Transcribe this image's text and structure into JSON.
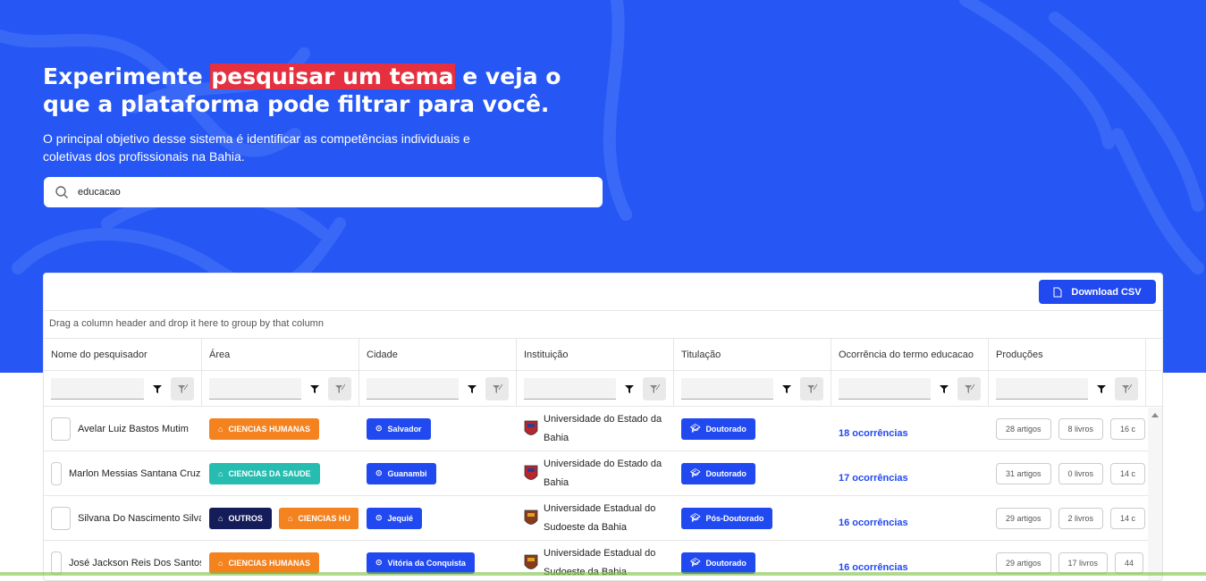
{
  "hero": {
    "title_before": "Experimente ",
    "title_highlight": "pesquisar um tema",
    "title_after": " e veja o que a plataforma pode filtrar para você.",
    "subtitle": "O principal objetivo desse sistema é identificar as competências individuais e coletivas dos profissionais na Bahia.",
    "accent_color": "#2657f5",
    "highlight_color": "#e5303f"
  },
  "search": {
    "value": "educacao",
    "icon": "search-icon"
  },
  "toolbar": {
    "download_label": "Download CSV",
    "download_icon": "file-csv-icon"
  },
  "grid": {
    "group_panel_text": "Drag a column header and drop it here to group by that column",
    "columns": [
      "Nome do pesquisador",
      "Área",
      "Cidade",
      "Instituição",
      "Titulação",
      "Ocorrência do termo educacao",
      "Produções"
    ],
    "rows": [
      {
        "name": "Avelar Luiz Bastos Mutim",
        "areas": [
          {
            "label": "CIENCIAS HUMANAS",
            "color": "orange"
          }
        ],
        "city": "Salvador",
        "institution": "Universidade do Estado da Bahia",
        "degree": "Doutorado",
        "occurrences": "18 ocorrências",
        "productions": [
          "28 artigos",
          "8 livros",
          "16 c"
        ]
      },
      {
        "name": "Marlon Messias Santana Cruz",
        "areas": [
          {
            "label": "CIENCIAS DA SAUDE",
            "color": "teal"
          }
        ],
        "city": "Guanambi",
        "institution": "Universidade do Estado da Bahia",
        "degree": "Doutorado",
        "occurrences": "17 ocorrências",
        "productions": [
          "31 artigos",
          "0 livros",
          "14 c"
        ]
      },
      {
        "name": "Silvana Do Nascimento Silva",
        "areas": [
          {
            "label": "OUTROS",
            "color": "navy"
          },
          {
            "label": "CIENCIAS HU",
            "color": "orange"
          }
        ],
        "city": "Jequié",
        "institution": "Universidade Estadual do Sudoeste da Bahia",
        "degree": "Pós-Doutorado",
        "occurrences": "16 ocorrências",
        "productions": [
          "29 artigos",
          "2 livros",
          "14 c"
        ]
      },
      {
        "name": "José Jackson Reis Dos Santos",
        "areas": [
          {
            "label": "CIENCIAS HUMANAS",
            "color": "orange"
          }
        ],
        "city": "Vitória da Conquista",
        "institution": "Universidade Estadual do Sudoeste da Bahia",
        "degree": "Doutorado",
        "occurrences": "16 ocorrências",
        "productions": [
          "29 artigos",
          "17 livros",
          "44"
        ]
      }
    ]
  }
}
